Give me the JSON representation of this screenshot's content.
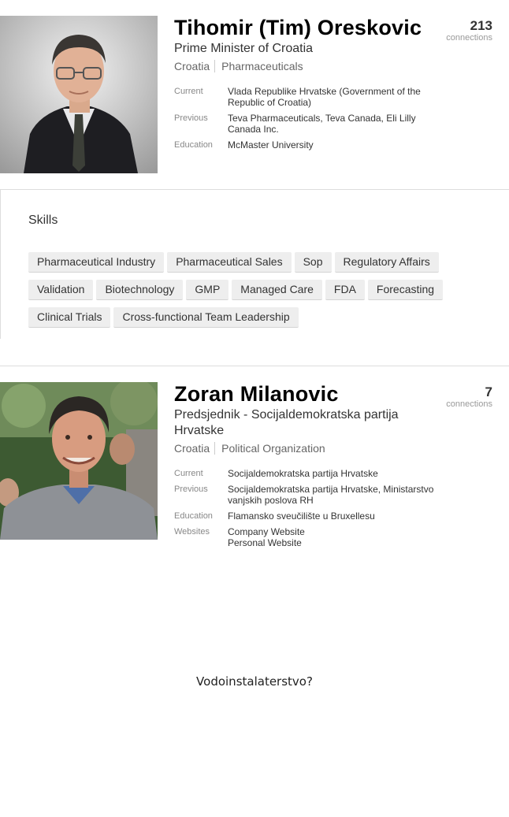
{
  "profiles": [
    {
      "name": "Tihomir (Tim) Oreskovic",
      "headline": "Prime Minister of Croatia",
      "location": "Croatia",
      "industry": "Pharmaceuticals",
      "connections": "213",
      "connections_label": "connections",
      "facts": [
        {
          "label": "Current",
          "value": "Vlada Republike Hrvatske (Government of the Republic of Croatia)"
        },
        {
          "label": "Previous",
          "value": "Teva Pharmaceuticals, Teva Canada, Eli Lilly Canada Inc."
        },
        {
          "label": "Education",
          "value": "McMaster University"
        }
      ]
    },
    {
      "name": "Zoran Milanovic",
      "headline": "Predsjednik - Socijaldemokratska partija Hrvatske",
      "location": "Croatia",
      "industry": "Political Organization",
      "connections": "7",
      "connections_label": "connections",
      "facts": [
        {
          "label": "Current",
          "value": "Socijaldemokratska partija Hrvatske"
        },
        {
          "label": "Previous",
          "value": "Socijaldemokratska partija Hrvatske, Ministarstvo vanjskih poslova RH"
        },
        {
          "label": "Education",
          "value": "Flamansko sveučilište u Bruxellesu"
        }
      ],
      "websites_label": "Websites",
      "websites": [
        "Company Website",
        "Personal Website"
      ]
    }
  ],
  "skills": {
    "title": "Skills",
    "items": [
      "Pharmaceutical Industry",
      "Pharmaceutical Sales",
      "Sop",
      "Regulatory Affairs",
      "Validation",
      "Biotechnology",
      "GMP",
      "Managed Care",
      "FDA",
      "Forecasting",
      "Clinical Trials",
      "Cross-functional Team Leadership"
    ]
  },
  "caption": "Vodoinstalaterstvo?"
}
